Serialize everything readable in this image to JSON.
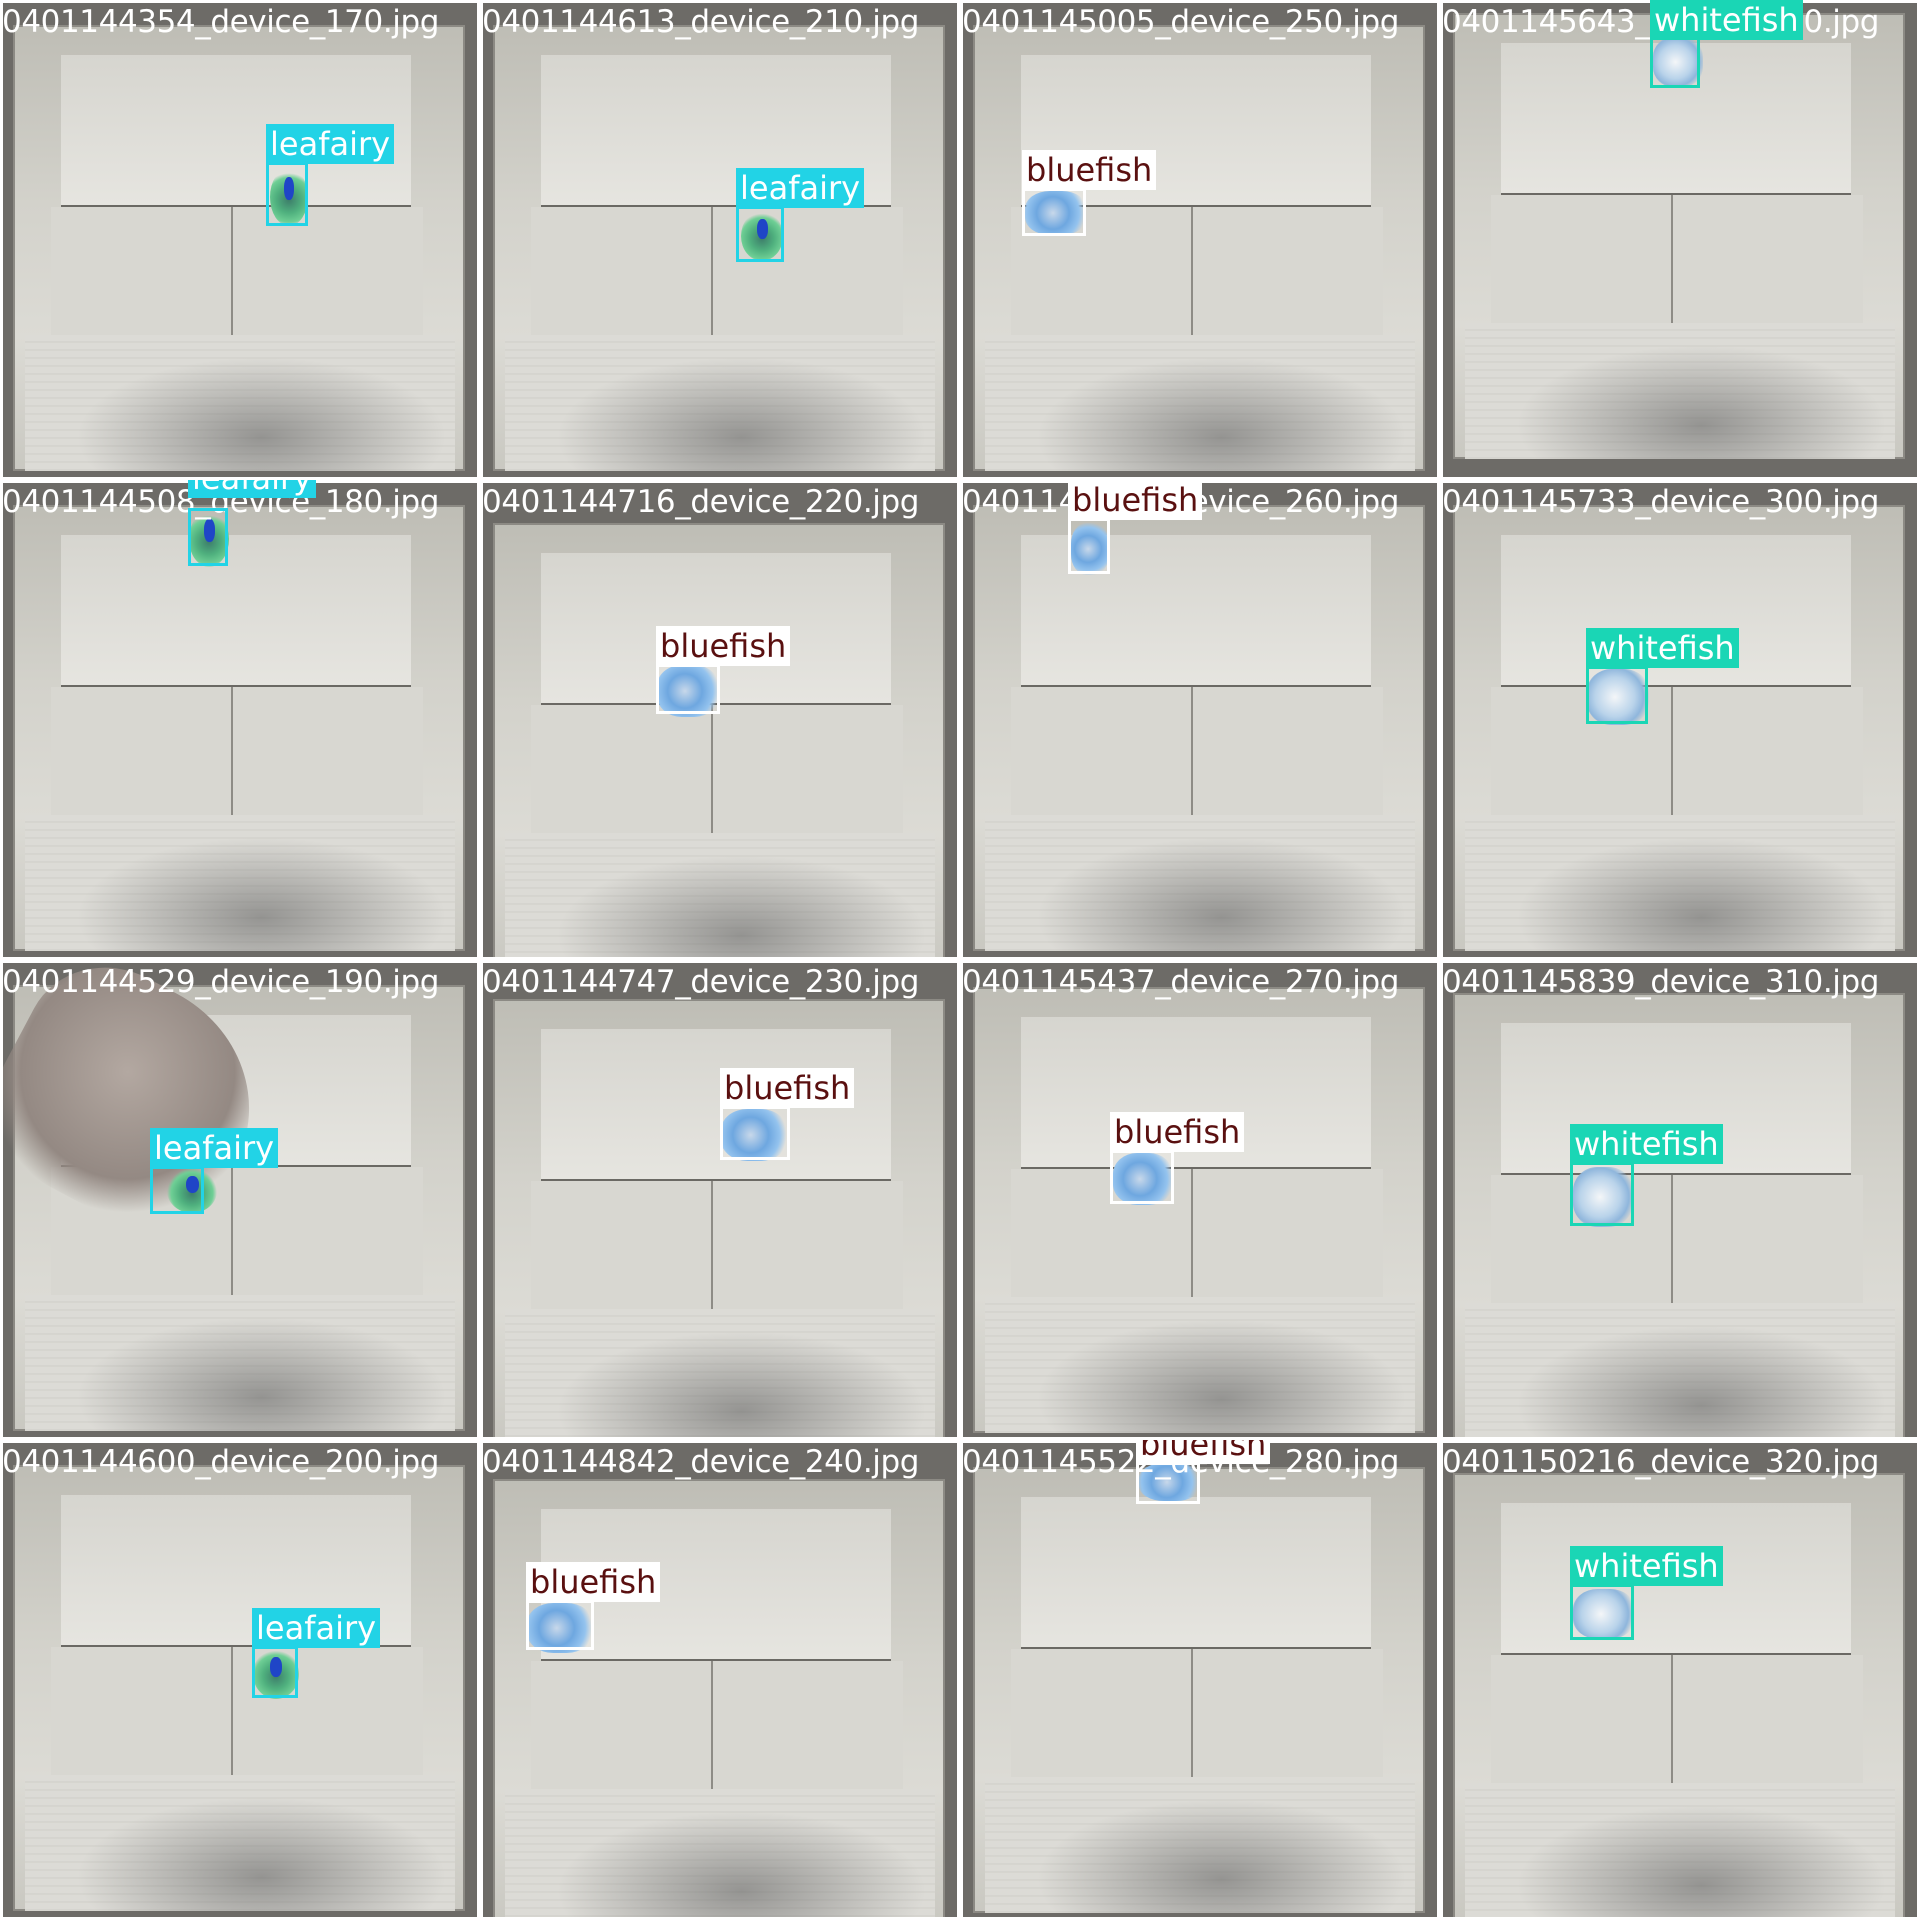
{
  "mosaic": {
    "tiles": [
      {
        "filename": "0401144354_device_170.jpg",
        "detections": [
          {
            "label": "leafairy"
          }
        ]
      },
      {
        "filename": "0401144613_device_210.jpg",
        "detections": [
          {
            "label": "leafairy"
          }
        ]
      },
      {
        "filename": "0401145005_device_250.jpg",
        "detections": [
          {
            "label": "bluefish"
          }
        ]
      },
      {
        "filename": "0401145643_device_290.jpg",
        "detections": [
          {
            "label": "whitefish"
          }
        ]
      },
      {
        "filename": "0401144508_device_180.jpg",
        "detections": [
          {
            "label": "leafairy"
          }
        ]
      },
      {
        "filename": "0401144716_device_220.jpg",
        "detections": [
          {
            "label": "bluefish"
          }
        ]
      },
      {
        "filename": "0401145139_device_260.jpg",
        "detections": [
          {
            "label": "bluefish"
          }
        ]
      },
      {
        "filename": "0401145733_device_300.jpg",
        "detections": [
          {
            "label": "whitefish"
          }
        ]
      },
      {
        "filename": "0401144529_device_190.jpg",
        "detections": [
          {
            "label": "leafairy"
          }
        ]
      },
      {
        "filename": "0401144747_device_230.jpg",
        "detections": [
          {
            "label": "bluefish"
          }
        ]
      },
      {
        "filename": "0401145437_device_270.jpg",
        "detections": [
          {
            "label": "bluefish"
          }
        ]
      },
      {
        "filename": "0401145839_device_310.jpg",
        "detections": [
          {
            "label": "whitefish"
          }
        ]
      },
      {
        "filename": "0401144600_device_200.jpg",
        "detections": [
          {
            "label": "leafairy"
          }
        ]
      },
      {
        "filename": "0401144842_device_240.jpg",
        "detections": [
          {
            "label": "bluefish"
          }
        ]
      },
      {
        "filename": "0401145522_device_280.jpg",
        "detections": [
          {
            "label": "bluefish"
          }
        ]
      },
      {
        "filename": "0401150216_device_320.jpg",
        "detections": [
          {
            "label": "whitefish"
          }
        ]
      }
    ]
  },
  "colors": {
    "leafairy": "#22d3e6",
    "bluefish": "#ffffff",
    "whitefish": "#1ad6b5"
  }
}
